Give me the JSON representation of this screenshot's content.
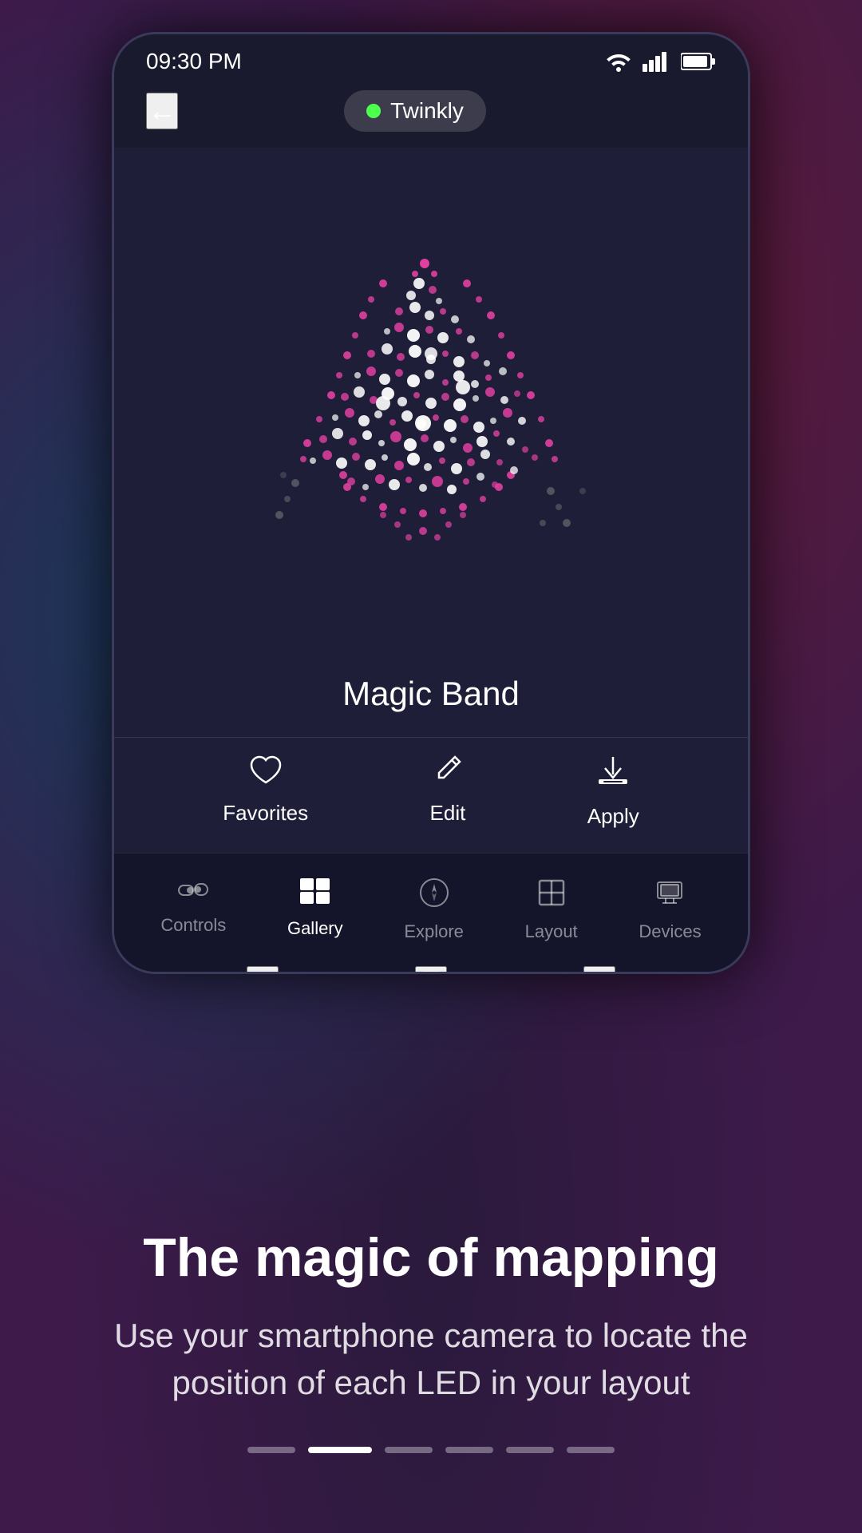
{
  "status": {
    "time": "09:30 PM",
    "wifi_icon": "📶",
    "signal_icon": "📶",
    "battery_icon": "🔋"
  },
  "header": {
    "back_label": "←",
    "badge_label": "Twinkly"
  },
  "effect": {
    "name": "Magic Band"
  },
  "actions": {
    "favorites_label": "Favorites",
    "edit_label": "Edit",
    "apply_label": "Apply"
  },
  "nav": {
    "tabs": [
      {
        "id": "controls",
        "label": "Controls",
        "active": false
      },
      {
        "id": "gallery",
        "label": "Gallery",
        "active": true
      },
      {
        "id": "explore",
        "label": "Explore",
        "active": false
      },
      {
        "id": "layout",
        "label": "Layout",
        "active": false
      },
      {
        "id": "devices",
        "label": "Devices",
        "active": false
      }
    ]
  },
  "bottom": {
    "title": "The magic of mapping",
    "subtitle": "Use your smartphone camera to locate the position of each LED in your layout"
  },
  "indicators": {
    "total": 6,
    "active_index": 1
  },
  "colors": {
    "bg": "#1e1e38",
    "phone_bg": "#1a1a2e",
    "accent_pink": "#e040a0",
    "accent_white": "#ffffff",
    "nav_bg": "#14142a"
  }
}
